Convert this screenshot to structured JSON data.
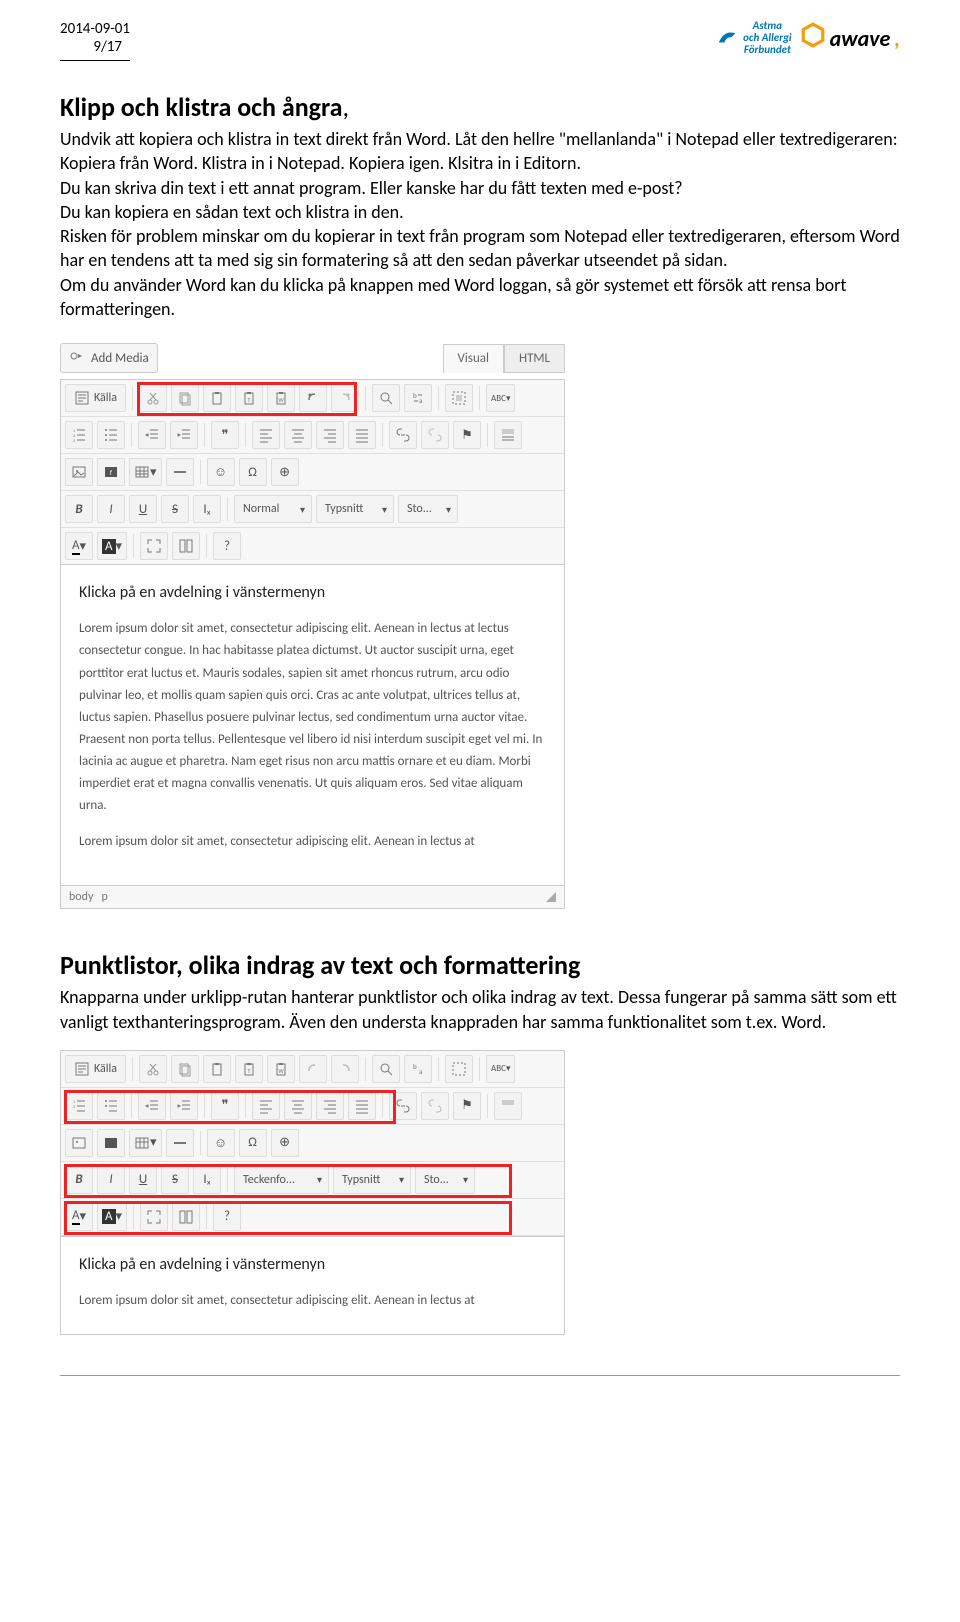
{
  "header": {
    "date": "2014-09-01",
    "page": "9/17",
    "logo_aaf_line1": "Astma",
    "logo_aaf_line2": "och Allergi",
    "logo_aaf_line3": "Förbundet",
    "logo_awave": "awave"
  },
  "section1": {
    "title": "Klipp och klistra och ångra",
    "p1": "Undvik att kopiera och klistra in text direkt från Word. Låt den hellre \"mellanlanda\" i Notepad eller textredigeraren: Kopiera från Word. Klistra in i Notepad. Kopiera igen. Klsitra in i Editorn.",
    "p2": "Du kan skriva din text i ett annat program. Eller kanske har du fått texten med e-post?",
    "p3": "Du kan kopiera en sådan text och klistra in den.",
    "p4": "Risken för problem minskar om du kopierar in text från program som Notepad eller textredigeraren, eftersom Word har en tendens att ta med sig sin formatering så att den sedan påverkar utseendet på sidan.",
    "p5": "Om du använder Word kan du klicka på knappen med Word loggan, så gör systemet ett försök att rensa bort formatteringen."
  },
  "editor1": {
    "add_media": "Add Media",
    "tab_visual": "Visual",
    "tab_html": "HTML",
    "source_btn": "Källa",
    "format_sel": "Normal",
    "font_sel": "Typsnitt",
    "size_sel": "Sto...",
    "abc_btn": "ABC",
    "heading": "Klicka på en avdelning i vänstermenyn",
    "para1": "Lorem ipsum dolor sit amet, consectetur adipiscing elit. Aenean in lectus at lectus consectetur congue. In hac habitasse platea dictumst. Ut auctor suscipit urna, eget porttitor erat luctus et. Mauris sodales, sapien sit amet rhoncus rutrum, arcu odio pulvinar leo, et mollis quam sapien quis orci. Cras ac ante volutpat, ultrices tellus at, luctus sapien. Phasellus posuere pulvinar lectus, sed condimentum urna auctor vitae. Praesent non porta tellus. Pellentesque vel libero id nisi interdum suscipit eget vel mi. In lacinia ac augue et pharetra. Nam eget risus non arcu mattis ornare et eu diam. Morbi imperdiet erat et magna convallis venenatis. Ut quis aliquam eros. Sed vitae aliquam urna.",
    "para2": "Lorem ipsum dolor sit amet, consectetur adipiscing elit. Aenean in lectus at",
    "path_body": "body",
    "path_p": "p"
  },
  "section2": {
    "title": "Punktlistor, olika indrag av text och formattering",
    "p1": "Knapparna under urklipp-rutan hanterar punktlistor och olika indrag av text. Dessa fungerar på samma sätt som ett vanligt texthanteringsprogram. Även den understa knappraden har samma funktionalitet som t.ex. Word."
  },
  "editor2": {
    "source_btn": "Källa",
    "format_sel": "Teckenfo...",
    "font_sel": "Typsnitt",
    "size_sel": "Sto...",
    "abc_btn": "ABC",
    "heading": "Klicka på en avdelning i vänstermenyn",
    "para1": "Lorem ipsum dolor sit amet, consectetur adipiscing elit. Aenean in lectus at"
  },
  "icons": {
    "a_label": "A",
    "b_label": "B",
    "i_label": "I",
    "u_label": "U",
    "s_label": "S",
    "ix_label": "Iₓ",
    "omega": "Ω",
    "globe": "⊕",
    "smile": "☺",
    "question": "?",
    "quote": "❞",
    "flag": "⚑",
    "anchor": "⚓"
  }
}
